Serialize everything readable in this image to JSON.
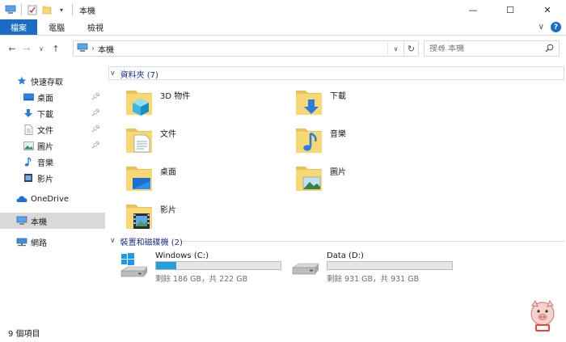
{
  "window": {
    "title": "本機",
    "minimize_glyph": "—",
    "maximize_glyph": "☐",
    "close_glyph": "✕"
  },
  "ribbon": {
    "tabs": [
      {
        "label": "檔案",
        "active": true
      },
      {
        "label": "電腦",
        "active": false
      },
      {
        "label": "檢視",
        "active": false
      }
    ],
    "help_glyph": "?",
    "collapse_glyph": "∨"
  },
  "nav": {
    "back_glyph": "←",
    "forward_glyph": "→",
    "recent_glyph": "∨",
    "up_glyph": "↑",
    "breadcrumb_sep": "›",
    "breadcrumb": "本機",
    "refresh_glyph": "↻",
    "search_placeholder": "搜尋 本機"
  },
  "sidebar": {
    "items": [
      {
        "label": "快速存取",
        "icon": "star-icon",
        "pinned": false
      },
      {
        "label": "桌面",
        "icon": "desktop-icon",
        "pinned": true
      },
      {
        "label": "下載",
        "icon": "download-icon",
        "pinned": true
      },
      {
        "label": "文件",
        "icon": "documents-icon",
        "pinned": true
      },
      {
        "label": "圖片",
        "icon": "pictures-icon",
        "pinned": true
      },
      {
        "label": "音樂",
        "icon": "music-icon",
        "pinned": false
      },
      {
        "label": "影片",
        "icon": "videos-icon",
        "pinned": false
      },
      {
        "label": "OneDrive",
        "icon": "onedrive-icon",
        "pinned": false
      },
      {
        "label": "本機",
        "icon": "this-pc-icon",
        "pinned": false,
        "selected": true
      },
      {
        "label": "網路",
        "icon": "network-icon",
        "pinned": false
      }
    ]
  },
  "groups": {
    "folders": {
      "header": "資料夾 (7)",
      "items": [
        {
          "label": "3D 物件",
          "icon": "3d-objects-folder-icon"
        },
        {
          "label": "下載",
          "icon": "downloads-folder-icon"
        },
        {
          "label": "文件",
          "icon": "documents-folder-icon"
        },
        {
          "label": "音樂",
          "icon": "music-folder-icon"
        },
        {
          "label": "桌面",
          "icon": "desktop-folder-icon"
        },
        {
          "label": "圖片",
          "icon": "pictures-folder-icon"
        },
        {
          "label": "影片",
          "icon": "videos-folder-icon"
        }
      ]
    },
    "drives": {
      "header": "裝置和磁碟機 (2)",
      "items": [
        {
          "label": "Windows (C:)",
          "icon": "windows-drive-icon",
          "used_fraction": 0.16,
          "info": "剩餘 186 GB，共 222 GB"
        },
        {
          "label": "Data (D:)",
          "icon": "hard-drive-icon",
          "used_fraction": 0.0,
          "info": "剩餘 931 GB，共 931 GB"
        }
      ]
    }
  },
  "status": {
    "count": "9 個項目"
  },
  "colors": {
    "accent": "#1a6cc4",
    "drive_fill": "#26a0da",
    "group_header": "#1e3287",
    "folder_yellow": "#f8d775"
  }
}
